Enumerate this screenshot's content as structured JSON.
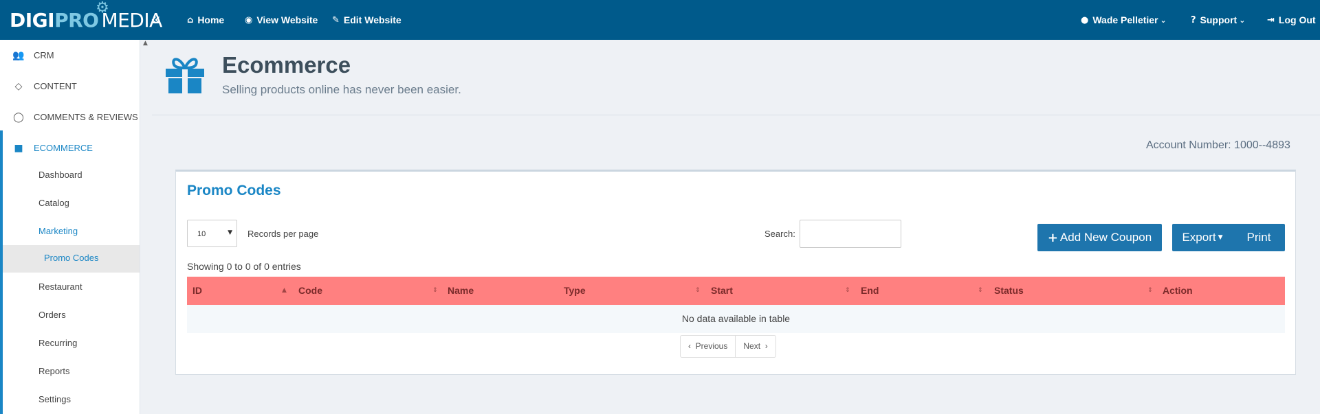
{
  "brand": {
    "part1": "DIGI",
    "part2": "PRO",
    "part3": "MEDIA"
  },
  "topnav": {
    "home": "Home",
    "view_website": "View Website",
    "edit_website": "Edit Website",
    "user": "Wade Pelletier",
    "support": "Support",
    "logout": "Log Out"
  },
  "sidebar": {
    "items": [
      {
        "label": "CRM",
        "icon": "users-icon"
      },
      {
        "label": "CONTENT",
        "icon": "diamond-icon"
      },
      {
        "label": "COMMENTS & REVIEWS",
        "icon": "comment-icon"
      },
      {
        "label": "ECOMMERCE",
        "icon": "gift-icon"
      }
    ],
    "sub": [
      "Dashboard",
      "Catalog",
      "Marketing",
      "Restaurant",
      "Orders",
      "Recurring",
      "Reports",
      "Settings"
    ],
    "subsub": "Promo Codes"
  },
  "header": {
    "title": "Ecommerce",
    "subtitle": "Selling products online has never been easier."
  },
  "account": "Account Number: 1000--4893",
  "panel": {
    "title": "Promo Codes",
    "per_page": "10",
    "per_page_label": "Records per page",
    "search_label": "Search:",
    "add_button": "Add New Coupon",
    "export_button": "Export",
    "print_button": "Print",
    "showing": "Showing 0 to 0 of 0 entries",
    "columns": [
      "ID",
      "Code",
      "Name",
      "Type",
      "Start",
      "End",
      "Status",
      "Action"
    ],
    "empty": "No data available in table",
    "prev": "Previous",
    "next": "Next"
  },
  "colors": {
    "topbar": "#005a8b",
    "accent": "#1a86c5",
    "table_header": "#ff8080"
  }
}
